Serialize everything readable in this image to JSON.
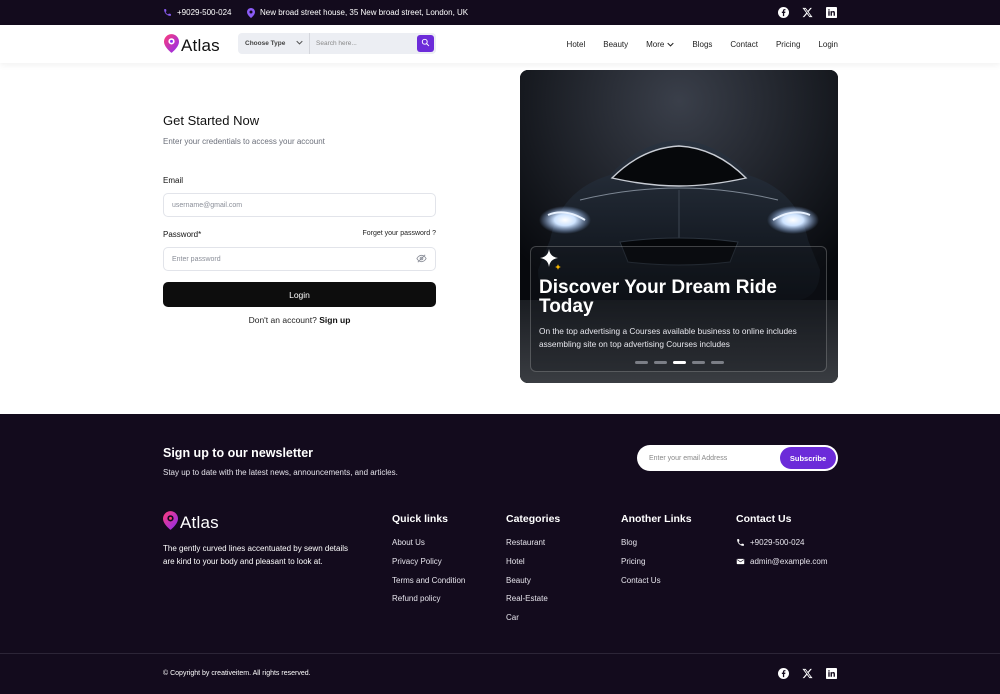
{
  "topbar": {
    "phone": "+9029-500-024",
    "address": "New broad street house, 35 New broad street, London, UK",
    "social": [
      "facebook-icon",
      "x-icon",
      "linkedin-icon"
    ]
  },
  "nav": {
    "brand": "Atlas",
    "search": {
      "type_label": "Choose Type",
      "placeholder": "Search here..."
    },
    "menu": {
      "hotel": "Hotel",
      "beauty": "Beauty",
      "more": "More",
      "blogs": "Blogs",
      "contact": "Contact",
      "pricing": "Pricing",
      "login": "Login"
    }
  },
  "form": {
    "title": "Get Started Now",
    "subtitle": "Enter your credentials to access your account",
    "email_label": "Email",
    "email_placeholder": "username@gmail.com",
    "password_label": "Password*",
    "forgot": "Forget your password ?",
    "password_placeholder": "Enter password",
    "login_button": "Login",
    "no_account": "Don't an account?",
    "signup": "Sign up"
  },
  "hero": {
    "title": "Discover Your Dream Ride Today",
    "description": "On the top advertising a Courses available business to online includes assembling site on top advertising Courses includes",
    "slides": 5,
    "active_slide": 3
  },
  "footer": {
    "newsletter": {
      "title": "Sign up to our newsletter",
      "subtitle": "Stay up to date with the latest news, announcements, and articles.",
      "placeholder": "Enter your email Address",
      "button": "Subscribe"
    },
    "brand": "Atlas",
    "description": "The gently curved lines accentuated by sewn details are kind to your body and pleasant to look at.",
    "quick_links": {
      "title": "Quick links",
      "items": [
        "About Us",
        "Privacy Policy",
        "Terms and Condition",
        "Refund policy"
      ]
    },
    "categories": {
      "title": "Categories",
      "items": [
        "Restaurant",
        "Hotel",
        "Beauty",
        "Real-Estate",
        "Car"
      ]
    },
    "another_links": {
      "title": "Another Links",
      "items": [
        "Blog",
        "Pricing",
        "Contact Us"
      ]
    },
    "contact": {
      "title": "Contact Us",
      "phone": "+9029-500-024",
      "email": "admin@example.com"
    },
    "copyright": "© Copyright by creativeitem. All rights reserved."
  },
  "colors": {
    "dark": "#130b1d",
    "accent": "#6c2bd9",
    "button": "#0d0d0d"
  }
}
